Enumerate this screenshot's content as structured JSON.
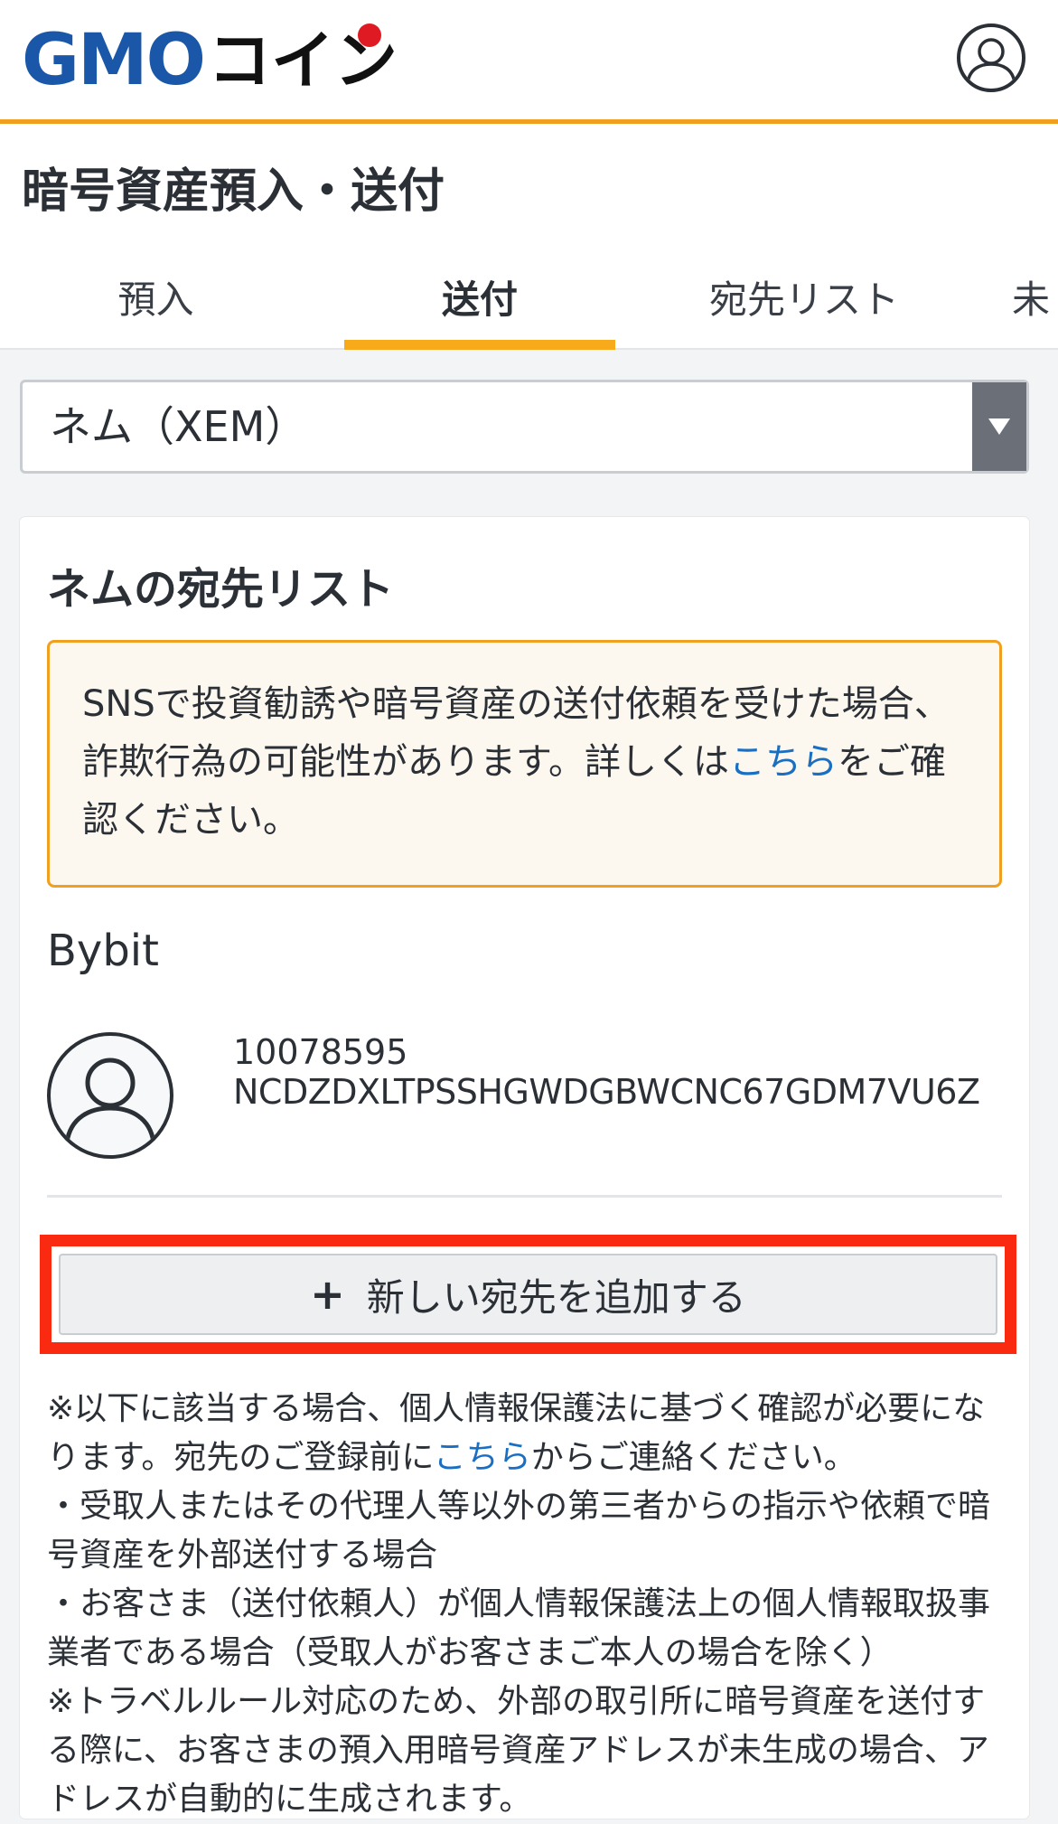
{
  "header": {
    "logo_gmo": "GMO",
    "logo_coin": "コイン",
    "account_icon": "user-circle-icon"
  },
  "page": {
    "title": "暗号資産預入・送付"
  },
  "tabs": [
    {
      "label": "預入",
      "active": false
    },
    {
      "label": "送付",
      "active": true
    },
    {
      "label": "宛先リスト",
      "active": false
    },
    {
      "label": "未",
      "active": false
    }
  ],
  "currency_select": {
    "value": "ネム（XEM）"
  },
  "card": {
    "title": "ネムの宛先リスト",
    "warning": {
      "text_before": "SNSで投資勧誘や暗号資産の送付依頼を受けた場合、詐欺行為の可能性があります。詳しくは",
      "link": "こちら",
      "text_after": "をご確認ください。"
    },
    "destination": {
      "name": "Bybit",
      "tag": "10078595",
      "address": "NCDZDXLTPSSHGWDGBWCNC67GDM7VU6Z"
    },
    "add_button": {
      "icon": "+",
      "label": "新しい宛先を追加する"
    },
    "notes": {
      "p1_before": "※以下に該当する場合、個人情報保護法に基づく確認が必要になります。宛先のご登録前に",
      "p1_link": "こちら",
      "p1_after": "からご連絡ください。",
      "p2": "・受取人またはその代理人等以外の第三者からの指示や依頼で暗号資産を外部送付する場合",
      "p3": "・お客さま（送付依頼人）が個人情報保護法上の個人情報取扱事業者である場合（受取人がお客さまご本人の場合を除く）",
      "p4": "※トラベルルール対応のため、外部の取引所に暗号資産を送付する際に、お客さまの預入用暗号資産アドレスが未生成の場合、アドレスが自動的に生成されます。"
    }
  },
  "colors": {
    "brand_blue": "#1a57a8",
    "accent_orange": "#f0a01e",
    "highlight_red": "#fa2a10",
    "link_blue": "#1b6fc2"
  }
}
